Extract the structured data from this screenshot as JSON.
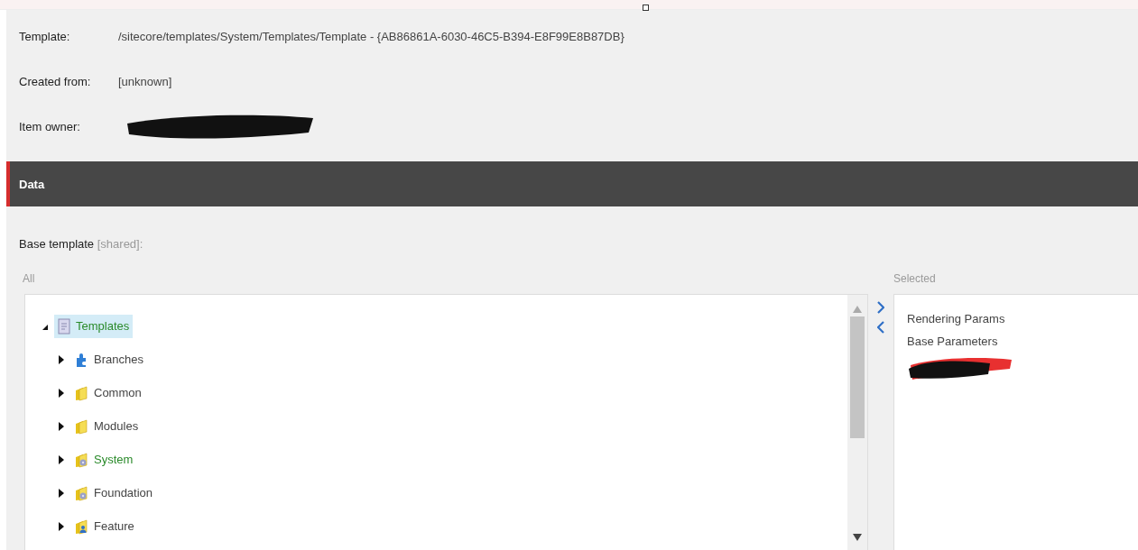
{
  "fields": [
    {
      "label": "Template:",
      "value": "/sitecore/templates/System/Templates/Template - {AB86861A-6030-46C5-B394-E8F99E8B87DB}",
      "kind": "text"
    },
    {
      "label": "Created from:",
      "value": "[unknown]",
      "kind": "text"
    },
    {
      "label": "Item owner:",
      "kind": "redacted"
    }
  ],
  "section": {
    "title": "Data"
  },
  "base_template": {
    "label": "Base template",
    "note": "[shared]:"
  },
  "all_list": {
    "title": "All",
    "tree": [
      {
        "label": "Templates",
        "kind": "document",
        "expanded": true,
        "selected": true,
        "highlighted": true,
        "children": [
          {
            "label": "Branches",
            "kind": "puzzle",
            "expanded": false,
            "selected": false,
            "highlighted": false
          },
          {
            "label": "Common",
            "kind": "folder",
            "expanded": false,
            "selected": false,
            "highlighted": false
          },
          {
            "label": "Modules",
            "kind": "folder",
            "expanded": false,
            "selected": false,
            "highlighted": false
          },
          {
            "label": "System",
            "kind": "folder-gear",
            "expanded": false,
            "selected": false,
            "highlighted": true
          },
          {
            "label": "Foundation",
            "kind": "folder-gear",
            "expanded": false,
            "selected": false,
            "highlighted": false
          },
          {
            "label": "Feature",
            "kind": "folder-user",
            "expanded": false,
            "selected": false,
            "highlighted": false
          }
        ]
      }
    ]
  },
  "selected_list": {
    "title": "Selected",
    "items": [
      {
        "kind": "text",
        "label": "Rendering Params"
      },
      {
        "kind": "text",
        "label": "Base Parameters"
      },
      {
        "kind": "redacted"
      }
    ]
  }
}
